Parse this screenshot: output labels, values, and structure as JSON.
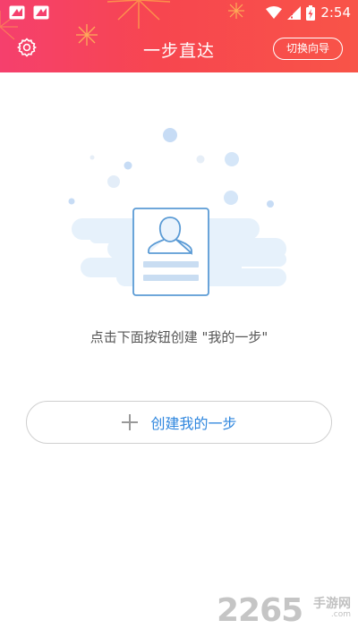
{
  "status_bar": {
    "time": "2:54",
    "icons": [
      "app-notification-icon",
      "app-notification-icon",
      "wifi-icon",
      "signal-icon",
      "battery-charging-icon"
    ]
  },
  "header": {
    "title": "一步直达",
    "switch_label": "切换向导",
    "settings_icon": "gear-icon"
  },
  "main": {
    "hint": "点击下面按钮创建 \"我的一步\"",
    "create_button_label": "创建我的一步",
    "create_button_icon": "plus-icon",
    "illustration_icon": "profile-card-icon"
  },
  "watermark": {
    "number": "2265",
    "site": "手游网",
    "url": ".com"
  },
  "colors": {
    "header_gradient_start": "#f5406d",
    "header_gradient_end": "#f85448",
    "accent_blue": "#2e86de",
    "illustration_blue": "#5b9bd5"
  }
}
